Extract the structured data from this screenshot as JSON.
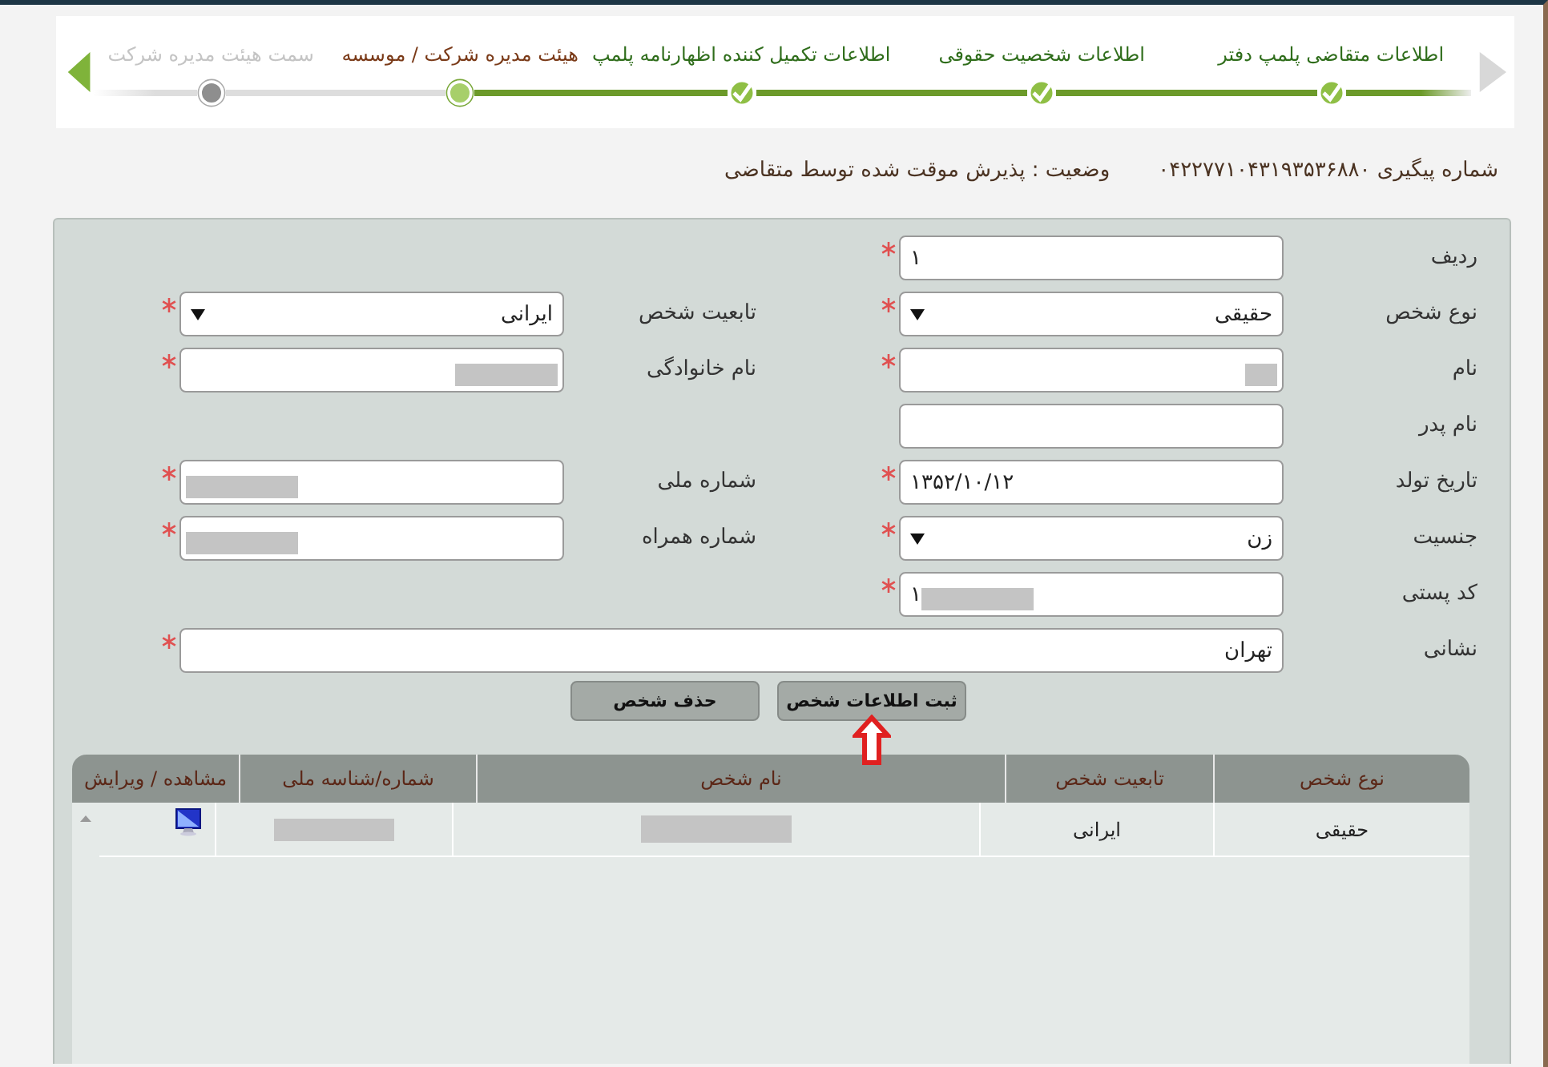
{
  "stepper": {
    "steps": [
      {
        "label": "اطلاعات متقاضی پلمپ دفتر",
        "completed": true,
        "selected": false
      },
      {
        "label": "اطلاعات شخصیت حقوقی",
        "completed": true,
        "selected": false
      },
      {
        "label": "اطلاعات تکمیل کننده اظهارنامه پلمپ",
        "completed": true,
        "selected": false
      },
      {
        "label": "هیئت مدیره شرکت / موسسه",
        "completed": false,
        "selected": true
      },
      {
        "label": "سمت هیئت مدیره شرکت",
        "completed": false,
        "selected": false
      }
    ]
  },
  "tracking": "شماره پیگیری ۰۴۲۲۷۷۱۰۴۳۱۹۳۵۳۶۸۸۰",
  "status": "وضعیت : پذیرش موقت شده توسط متقاضی",
  "form": {
    "rows": [
      {
        "fields": [
          {
            "label": "ردیف",
            "kind": "number",
            "value": "۱",
            "required": true
          }
        ]
      },
      {
        "fields": [
          {
            "label": "نوع شخص",
            "kind": "select",
            "value": "حقیقی",
            "required": true
          },
          {
            "label": "تابعیت شخص",
            "kind": "select",
            "value": "ایرانی",
            "required": true
          }
        ]
      },
      {
        "fields": [
          {
            "label": "نام",
            "kind": "text",
            "redacted": true,
            "required": true
          },
          {
            "label": "نام خانوادگی",
            "kind": "text",
            "redacted": true,
            "required": true
          }
        ]
      },
      {
        "fields": [
          {
            "label": "نام پدر",
            "kind": "text",
            "required": false
          }
        ]
      },
      {
        "fields": [
          {
            "label": "تاریخ تولد",
            "kind": "number",
            "value": "۱۳۵۲/۱۰/۱۲",
            "required": true
          },
          {
            "label": "شماره ملی",
            "kind": "number",
            "redacted": true,
            "required": true
          }
        ]
      },
      {
        "fields": [
          {
            "label": "جنسیت",
            "kind": "select",
            "value": "زن",
            "required": true
          },
          {
            "label": "شماره همراه",
            "kind": "number",
            "redacted": true,
            "required": true
          }
        ]
      },
      {
        "fields": [
          {
            "label": "کد پستی",
            "kind": "number",
            "value": "۱",
            "redacted": true,
            "required": true
          }
        ]
      },
      {
        "fields": [
          {
            "label": "نشانی",
            "kind": "wide_text",
            "value": "تهران",
            "required": true
          }
        ]
      }
    ],
    "buttons": [
      {
        "label": "ثبت اطلاعات شخص",
        "pointed": true
      },
      {
        "label": "حذف شخص",
        "pointed": false
      }
    ]
  },
  "table": {
    "columns": [
      "نوع شخص",
      "تابعیت شخص",
      "نام شخص",
      "شماره/شناسه ملی",
      "مشاهده / ویرایش"
    ],
    "rows": [
      {
        "cells": [
          {
            "kind": "text",
            "text": "حقیقی"
          },
          {
            "kind": "text",
            "text": "ایرانی"
          },
          {
            "kind": "redacted"
          },
          {
            "kind": "redacted"
          },
          {
            "kind": "edit_icon"
          }
        ]
      }
    ]
  }
}
